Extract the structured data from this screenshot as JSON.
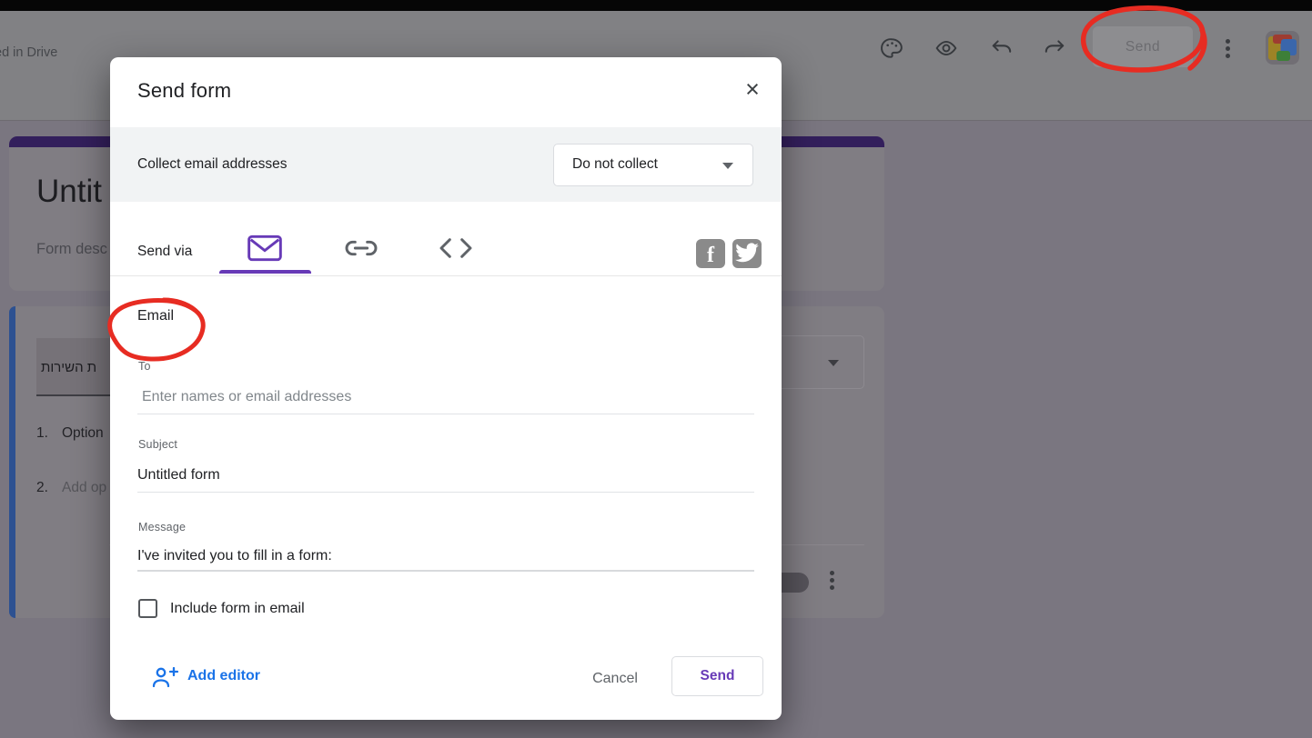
{
  "colors": {
    "accent_purple": "#673ab7",
    "link_blue": "#1a73e8",
    "annotation_red": "#e72c22",
    "band_grey": "#f1f3f4"
  },
  "topbar": {
    "saved_status": "ed in Drive",
    "send_label": "Send",
    "icons": [
      "palette-icon",
      "eye-icon",
      "undo-icon",
      "redo-icon",
      "more-menu",
      "avatar"
    ]
  },
  "background": {
    "form_title": "Untit",
    "form_description": "Form desc",
    "question_text": "ת השירות",
    "options": [
      {
        "num": "1.",
        "label": "Option"
      },
      {
        "num": "2.",
        "label": "Add op"
      }
    ]
  },
  "dialog": {
    "title": "Send form",
    "close_glyph": "×",
    "collect_row": {
      "label": "Collect email addresses",
      "dropdown_value": "Do not collect"
    },
    "send_via": {
      "label": "Send via",
      "tabs": [
        "email",
        "link",
        "embed"
      ],
      "selected_tab": "email",
      "facebook_glyph": "f"
    },
    "email_section": {
      "heading": "Email",
      "to_label": "To",
      "to_placeholder": "Enter names or email addresses",
      "subject_label": "Subject",
      "subject_value": "Untitled form",
      "message_label": "Message",
      "message_value": "I've invited you to fill in a form:",
      "include_label": "Include form in email",
      "include_checked": false
    },
    "footer": {
      "add_editor": "Add editor",
      "cancel": "Cancel",
      "send": "Send"
    }
  }
}
